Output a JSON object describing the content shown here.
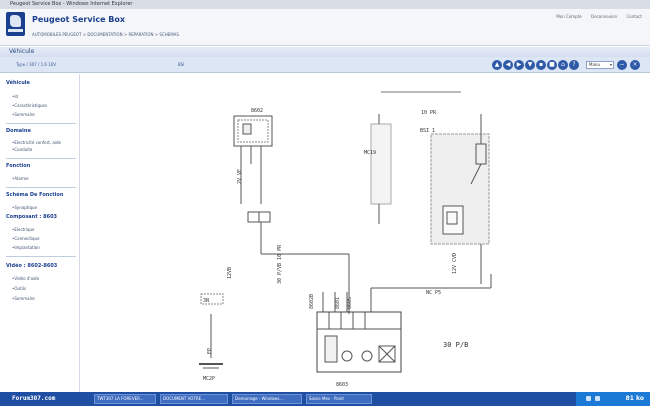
{
  "window": {
    "title": "Peugeot Service Box - Windows Internet Explorer"
  },
  "header": {
    "app_title": "Peugeot Service Box",
    "breadcrumb": "AUTOMOBILES PEUGEOT > DOCUMENTATION > REPARATION > SCHEMAS",
    "links": [
      "Mon Compte",
      "Deconnexion",
      "Contact"
    ]
  },
  "banner": {
    "label": "Véhicule"
  },
  "toolbar": {
    "left_text": "Type / 307 / 1.6 16V",
    "mid_text": "BSI",
    "nav_icons": [
      "circle-arrow-up",
      "circle-arrow-left",
      "circle-arrow-right",
      "circle-arrow-down",
      "print",
      "save",
      "home",
      "help"
    ],
    "lang_select": "Manu",
    "extra_icons": [
      "minus",
      "close"
    ]
  },
  "sidebar": {
    "sections": [
      {
        "title": "Véhicule",
        "items": [
          "Id",
          "Caractéristiques",
          "Sommaire"
        ]
      },
      {
        "title": "Domaine",
        "items": [
          "Electricité confort, aide",
          "Conduite"
        ]
      },
      {
        "title": "Fonction",
        "items": [
          "Alarme"
        ]
      },
      {
        "title": "Schéma De Fonction",
        "items": [
          "Synoptique"
        ]
      },
      {
        "title": "Composant : 8603",
        "items": [
          "Electrique",
          "Connectique",
          "Implantation"
        ]
      },
      {
        "title": "Vidéo : 8602-8603",
        "items": [
          "Vidéo d'aide",
          "Outils",
          "Sommaire"
        ]
      }
    ]
  },
  "diagram": {
    "labels": {
      "comp_8602": "8602",
      "comp_8603": "8603",
      "comp_bsi": "BSI 1",
      "ref_10pr": "10 PR",
      "ref_30pvb": "30 P/B",
      "ref_30pvb_vert": "30 P/VB 10 PR",
      "ref_12vb": "12VB",
      "ref_mc": "MC19",
      "ref_ep": "EP",
      "ref_mc2": "MC2P",
      "ref_8602b": "8602B",
      "ref_3n": "3N",
      "wire_ncp5": "NC P5",
      "wire_8601": "8601",
      "wire_8605": "8605",
      "wire_2v_ve": "2V VE",
      "wire_12v_cvd": "12V CVD"
    }
  },
  "taskbar": {
    "brand": "Forum307.com",
    "tasks": [
      "TWT307 LA FOREVER...",
      "DOCUMENT VOTRE...",
      "Demarrage - Windows...",
      "Saisie Mes - Paint"
    ],
    "tray_time": "81 ko"
  }
}
